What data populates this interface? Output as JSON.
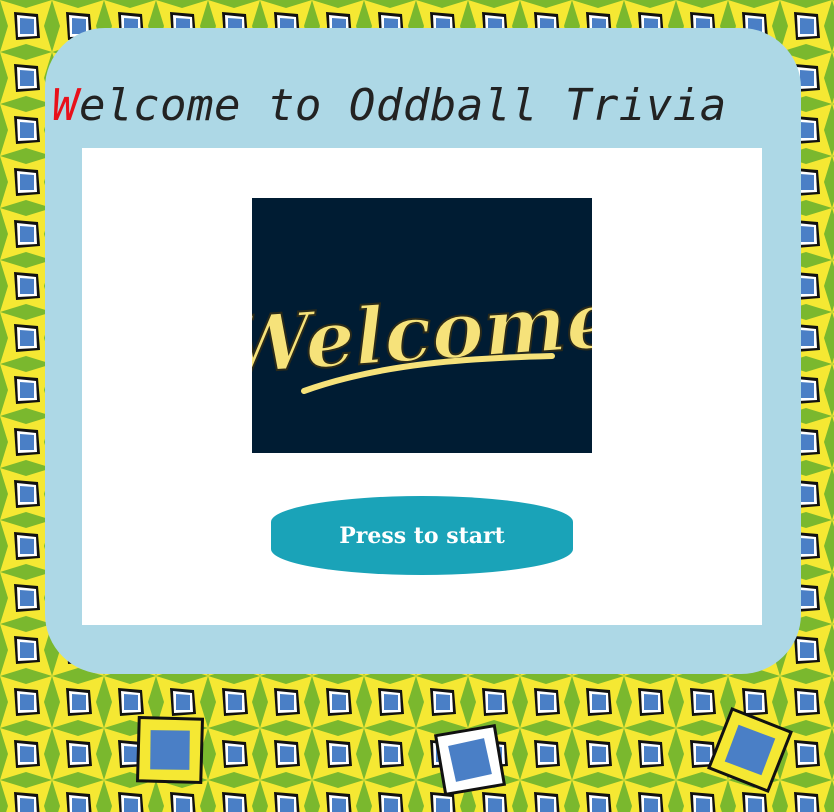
{
  "page": {
    "title_first_letter": "W",
    "title_rest": "elcome to Oddball Trivia",
    "start_button_label": "Press to start",
    "welcome_image_text": "Welcome"
  },
  "colors": {
    "card_background": "#add8e6",
    "title_accent": "#e8101a",
    "button_background": "#1aa3b8",
    "image_background": "#001c33",
    "welcome_text": "#f6e27a",
    "page_pattern_green": "#7ab82e",
    "page_pattern_yellow": "#f5e833",
    "page_pattern_blue": "#4a7fc6"
  }
}
